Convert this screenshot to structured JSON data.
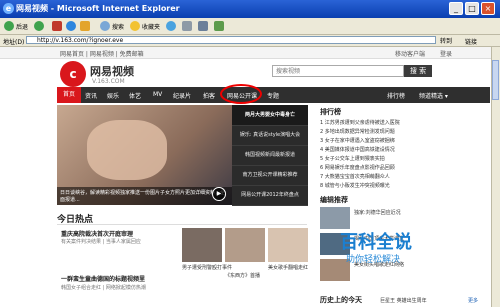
{
  "window": {
    "title": "网易视频 - Microsoft Internet Explorer",
    "ie_icon": "e"
  },
  "toolbar": {
    "back_label": "后退",
    "search_label": "搜索",
    "favorites_label": "收藏夹"
  },
  "address": {
    "label": "地址(D)",
    "url": "http://v.163.com/?ignoer.eve",
    "go_label": "转到",
    "links_label": "链接"
  },
  "topnav": {
    "left": "网易首页  |  网易视频  |  免费邮箱",
    "right": [
      "移动客户端",
      "登录"
    ]
  },
  "logo": {
    "badge": "c",
    "name": "网易视频",
    "url": "V.163.COM"
  },
  "search": {
    "placeholder": "搜索视频",
    "button_label": "搜 索",
    "hotwords": "热门: 魅族  明星  xxx纪录片  女子减肥视频"
  },
  "nav": {
    "items": [
      "首页",
      "资讯",
      "娱乐",
      "体艺",
      "MV",
      "纪录片",
      "拍客",
      "网易公开课",
      "专题"
    ],
    "right_items": [
      "排行榜",
      "频道精选 ▾"
    ]
  },
  "main_video": {
    "caption": "日日谈峡谷，解读精彩视频独家推送一份图片子女方照片更加详细资料，全面报道..."
  },
  "side_list": [
    "两月大男婴女中毒身亡",
    "娱乐: 真话说style演唱大会",
    "韩国视频新闻最新报道",
    "南方卫视公开课精彩推荐",
    "网易公开课2012年终盘点"
  ],
  "right": {
    "rank_title": "排行榜",
    "ranks": [
      "1 江苏男孩遭到父亲虐待被送入医院",
      "2 多地出现数据异常检测发现问题",
      "3 女子在家中遭遇入室盗窃被捆绑",
      "4 美国媒体报道中国高铁建设情况",
      "5 女子公交车上遭到猥亵实拍",
      "6 网易娱乐年度盘点影视作品回顾",
      "7 大熊猫宝宝首次亮相萌翻众人",
      "8 城管与小贩发生冲突视频曝光"
    ],
    "rec_title": "编辑推荐",
    "recs": [
      "独家:刘德华回应近况",
      "揭秘中国顶尖大学课堂",
      "美女街头唱歌走红网络"
    ],
    "history_title": "历史上的今天",
    "history_text": "巨星王 英雄出生周年",
    "history_link": "更多"
  },
  "todayhot": {
    "title": "今日热点",
    "items": [
      {
        "title": "重庆高院裁决首次开庭审理",
        "sub": "有关案件判决结果 | 当事人家属回应"
      },
      {
        "title": "一群蛮生童曲德国的标题视频里",
        "sub": "韩国女子组合走红 | 网络掀起模仿热潮"
      }
    ],
    "thumbs": [
      "男子遭受刑警殴打事件",
      "《东西方》首播",
      "美女歌手翻唱走红"
    ]
  },
  "watermark": {
    "big": "百科全说",
    "small": "助你轻松解决"
  }
}
